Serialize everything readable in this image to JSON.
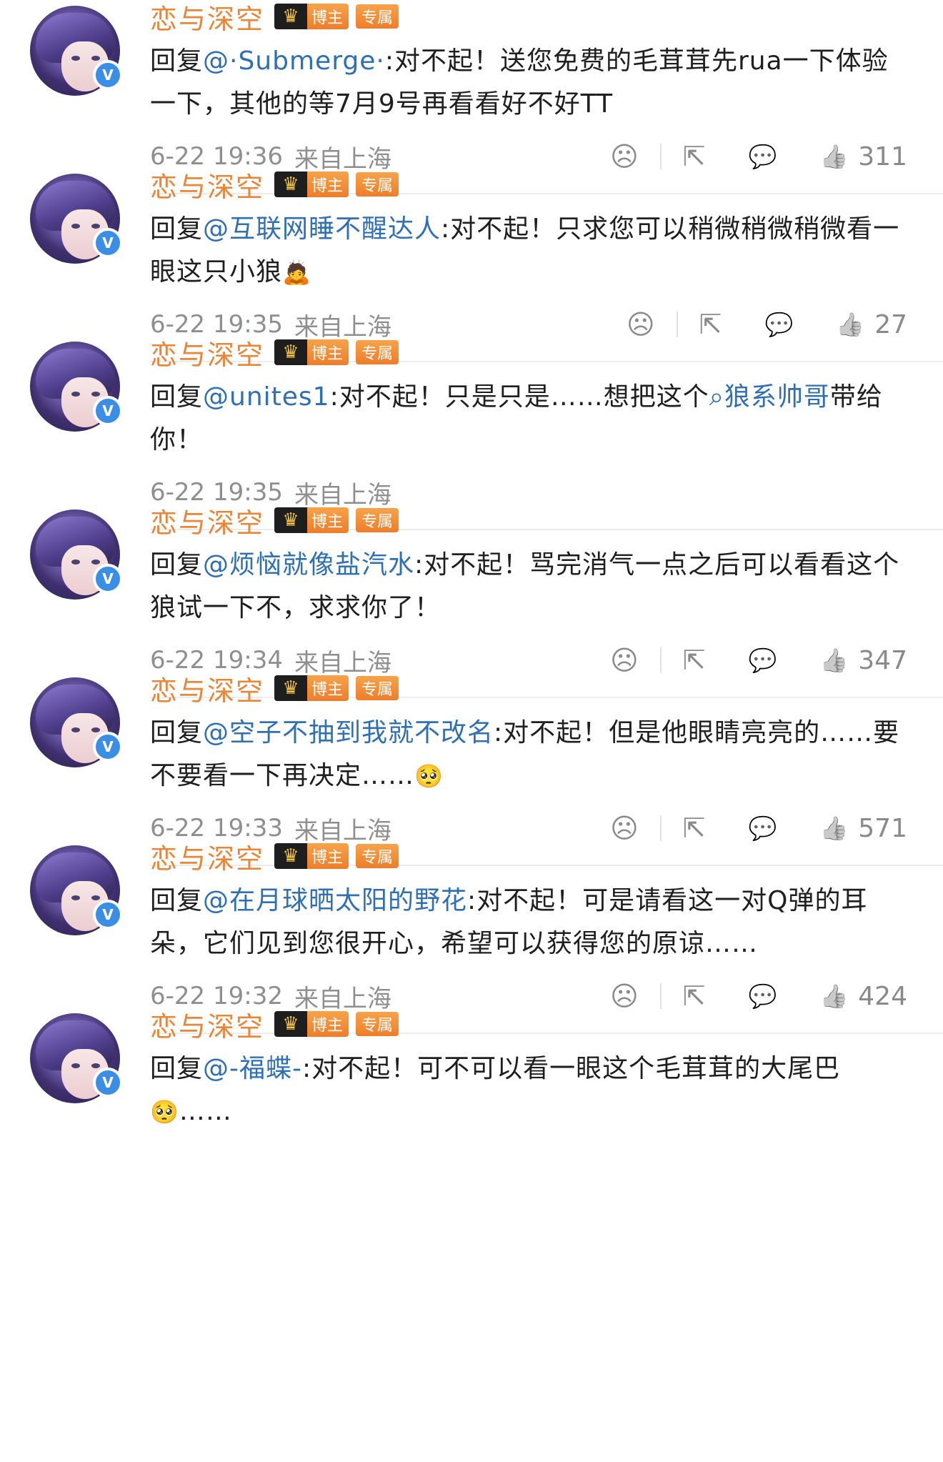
{
  "comments": [
    {
      "username": "恋与深空",
      "badge": "博主",
      "tag": "专属",
      "reply_prefix": "回复",
      "mention": "@·Submerge·",
      "text": ":对不起！送您免费的毛茸茸先rua一下体验一下，其他的等7月9号再看看好不好TT",
      "time": "6-22 19:36",
      "source": "来自上海",
      "likes": "311",
      "show_actions": true
    },
    {
      "username": "恋与深空",
      "badge": "博主",
      "tag": "专属",
      "reply_prefix": "回复",
      "mention": "@互联网睡不醒达人",
      "text": ":对不起！只求您可以稍微稍微稍微看一眼这只小狼",
      "emoji": "🙇",
      "time": "6-22 19:35",
      "source": "来自上海",
      "likes": "27",
      "show_actions": true
    },
    {
      "username": "恋与深空",
      "badge": "博主",
      "tag": "专属",
      "reply_prefix": "回复",
      "mention": "@unites1",
      "text": ":对不起！只是只是……想把这个",
      "search_link": "狼系帅哥",
      "text_after": "带给你！",
      "time": "6-22 19:35",
      "source": "来自上海",
      "show_actions": false
    },
    {
      "username": "恋与深空",
      "badge": "博主",
      "tag": "专属",
      "reply_prefix": "回复",
      "mention": "@烦恼就像盐汽水",
      "text": ":对不起！骂完消气一点之后可以看看这个狼试一下不，求求你了！",
      "time": "6-22 19:34",
      "source": "来自上海",
      "likes": "347",
      "show_actions": true
    },
    {
      "username": "恋与深空",
      "badge": "博主",
      "tag": "专属",
      "reply_prefix": "回复",
      "mention": "@空子不抽到我就不改名",
      "text": ":对不起！但是他眼睛亮亮的……要不要看一下再决定……",
      "emoji": "🥺",
      "time": "6-22 19:33",
      "source": "来自上海",
      "likes": "571",
      "show_actions": true
    },
    {
      "username": "恋与深空",
      "badge": "博主",
      "tag": "专属",
      "reply_prefix": "回复",
      "mention": "@在月球晒太阳的野花",
      "text": ":对不起！可是请看这一对Q弹的耳朵，它们见到您很开心，希望可以获得您的原谅……",
      "time": "6-22 19:32",
      "source": "来自上海",
      "likes": "424",
      "show_actions": true
    },
    {
      "username": "恋与深空",
      "badge": "博主",
      "tag": "专属",
      "reply_prefix": "回复",
      "mention": "@-福蝶-",
      "text": ":对不起！可不可以看一眼这个毛茸茸的大尾巴",
      "emoji": "🥺",
      "text_after": "……",
      "show_actions": false
    }
  ],
  "icons": {
    "verified": "v-verified-icon",
    "crown": "crown-icon",
    "dislike": "sad-face-icon",
    "share": "share-icon",
    "comment": "comment-icon",
    "like": "thumbs-up-icon",
    "search": "search-icon"
  },
  "colors": {
    "username": "#e8863a",
    "mention": "#2f6fb3",
    "meta": "#8f8f8f",
    "verified": "#3a8ee6"
  }
}
